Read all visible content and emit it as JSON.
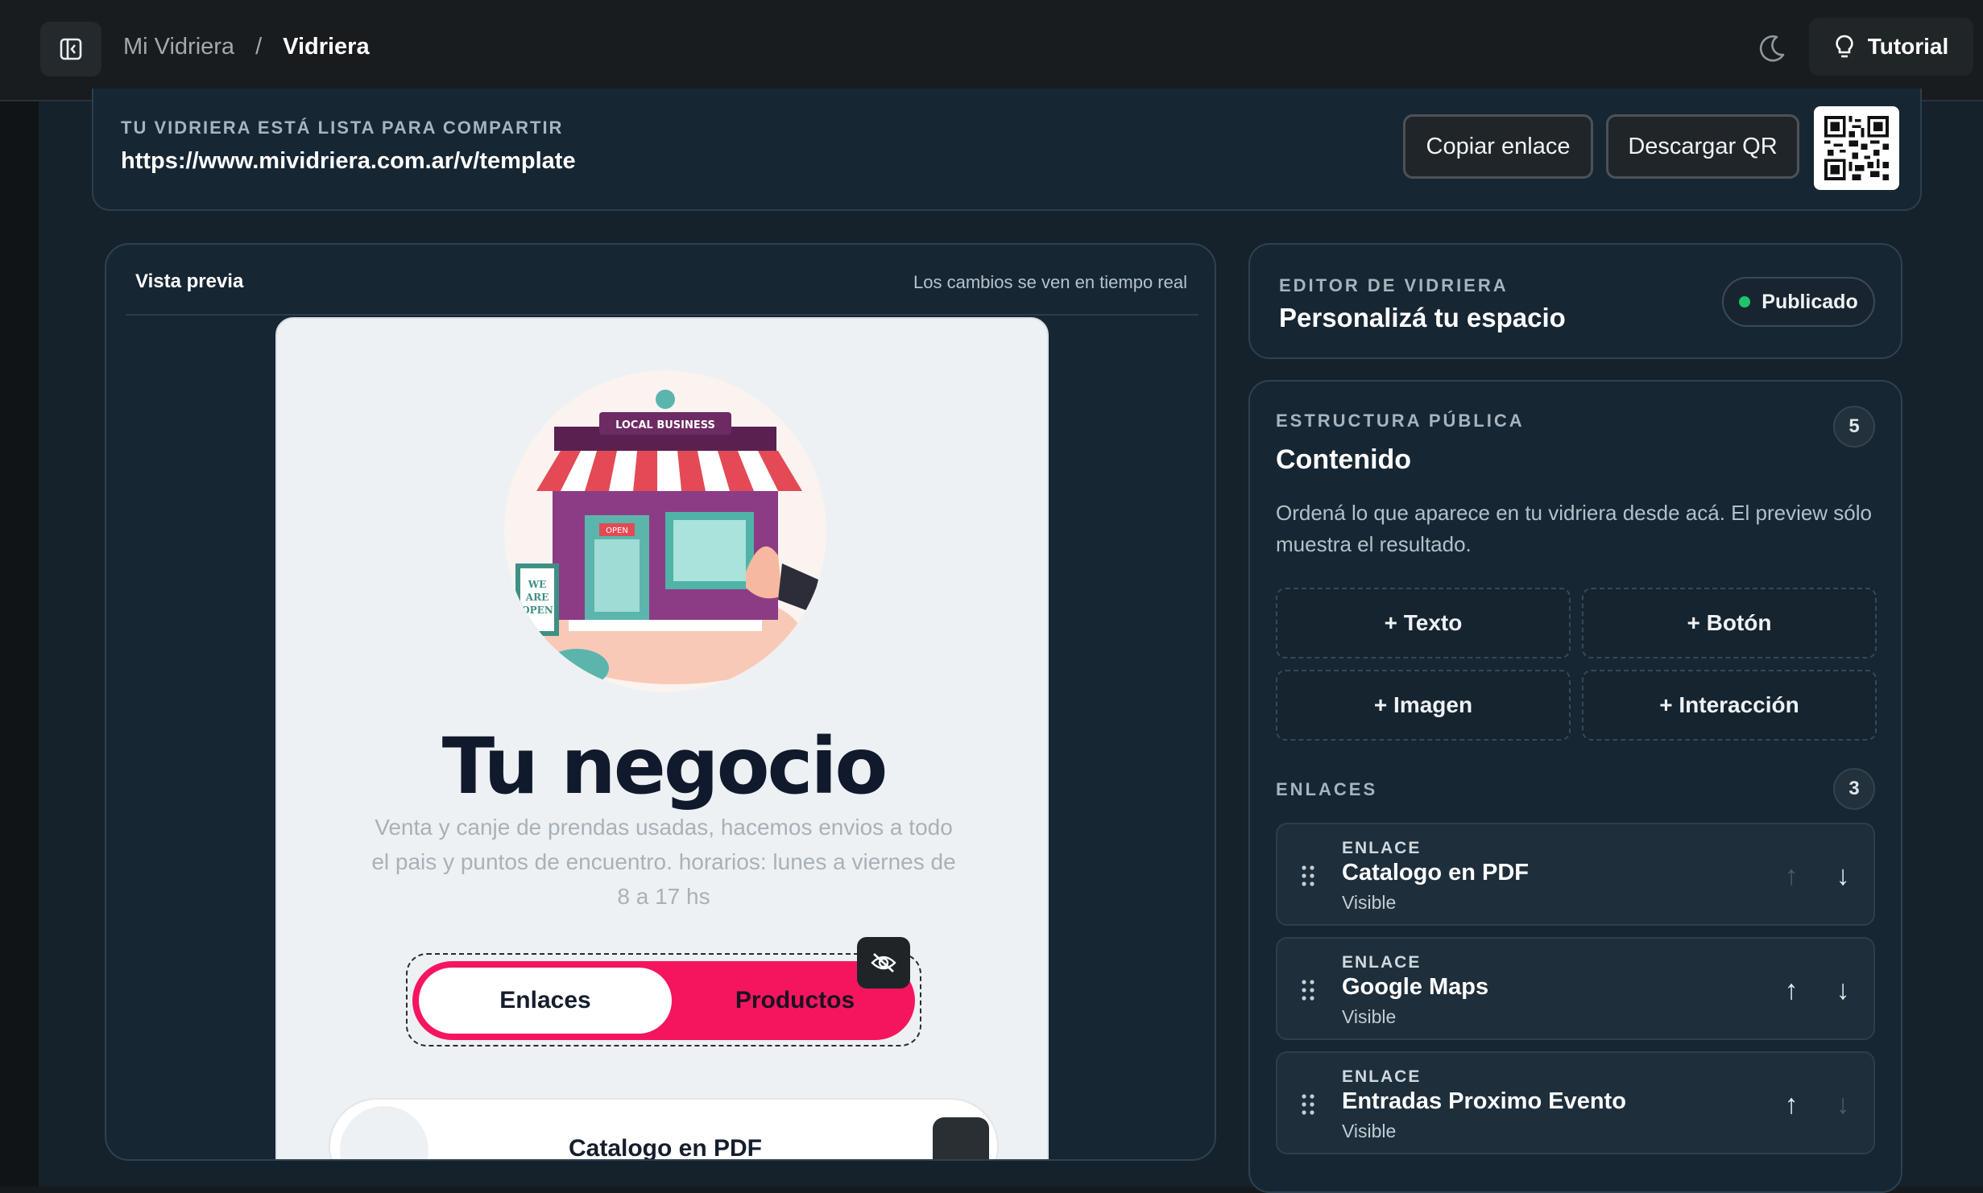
{
  "breadcrumb": {
    "parent": "Mi Vidriera",
    "separator": "/",
    "current": "Vidriera"
  },
  "header": {
    "tutorial_label": "Tutorial"
  },
  "share": {
    "label": "TU VIDRIERA ESTÁ LISTA PARA COMPARTIR",
    "url": "https://www.mividriera.com.ar/v/template",
    "copy_label": "Copiar enlace",
    "download_label": "Descargar QR"
  },
  "preview": {
    "title": "Vista previa",
    "subtitle": "Los cambios se ven en tiempo real",
    "business_name": "Tu negocio",
    "description": "Venta y canje de prendas usadas, hacemos envios a todo el pais y puntos de encuentro. horarios: lunes a viernes de 8 a 17 hs",
    "tabs": [
      {
        "label": "Enlaces",
        "active": true
      },
      {
        "label": "Productos",
        "active": false
      }
    ],
    "first_link": "Catalogo en PDF",
    "illustration": {
      "sign": "LOCAL BUSINESS",
      "door_sign": "OPEN",
      "board": [
        "WE",
        "ARE",
        "OPEN"
      ]
    }
  },
  "editor": {
    "eyebrow": "EDITOR DE VIDRIERA",
    "title": "Personalizá tu espacio",
    "status": "Publicado",
    "status_color": "#1fc46b"
  },
  "content": {
    "eyebrow": "ESTRUCTURA PÚBLICA",
    "count": "5",
    "title": "Contenido",
    "description": "Ordená lo que aparece en tu vidriera desde acá. El preview sólo muestra el resultado.",
    "add_buttons": [
      "+ Texto",
      "+ Botón",
      "+ Imagen",
      "+ Interacción"
    ],
    "links_eyebrow": "ENLACES",
    "links_count": "3",
    "links": [
      {
        "type": "ENLACE",
        "title": "Catalogo en PDF",
        "status": "Visible"
      },
      {
        "type": "ENLACE",
        "title": "Google Maps",
        "status": "Visible"
      },
      {
        "type": "ENLACE",
        "title": "Entradas Proximo Evento",
        "status": "Visible"
      }
    ]
  },
  "colors": {
    "accent": "#f5155e",
    "background": "#15222c"
  }
}
